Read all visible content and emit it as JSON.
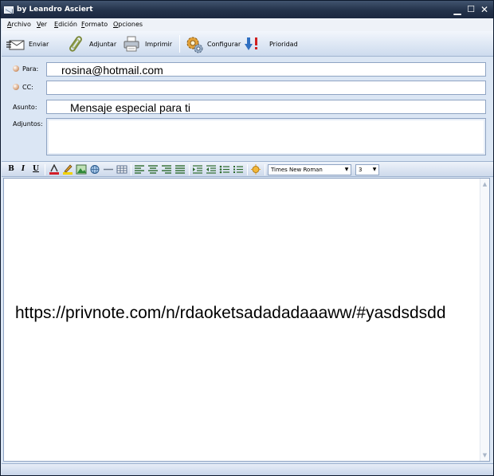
{
  "window": {
    "title": "by Leandro Asciert",
    "controls": {
      "minimize": "▁",
      "maximize": "☐",
      "close": "✕"
    }
  },
  "menu": [
    "Archivo",
    "Ver",
    "Edición",
    "Formato",
    "Opciones"
  ],
  "toolbar": {
    "send": "Enviar",
    "attach": "Adjuntar",
    "print": "Imprimir",
    "configure": "Configurar",
    "priority": "Prioridad"
  },
  "fields": {
    "to_label": "Para:",
    "to_value": "rosina@hotmail.com",
    "cc_label": "CC:",
    "cc_value": "",
    "subject_label": "Asunto:",
    "subject_value": "Mensaje especial para ti",
    "attachments_label": "Adjuntos:"
  },
  "format": {
    "bold": "B",
    "italic": "I",
    "underline": "U",
    "font": "Times New Roman",
    "size": "3"
  },
  "body": {
    "text": "https://privnote.com/n/rdaoketsadadadaaaww/#yasdsdsdd"
  },
  "colors": {
    "titlebar": "#23324a",
    "panel": "#dbe6f4",
    "border": "#8fa4c3"
  }
}
